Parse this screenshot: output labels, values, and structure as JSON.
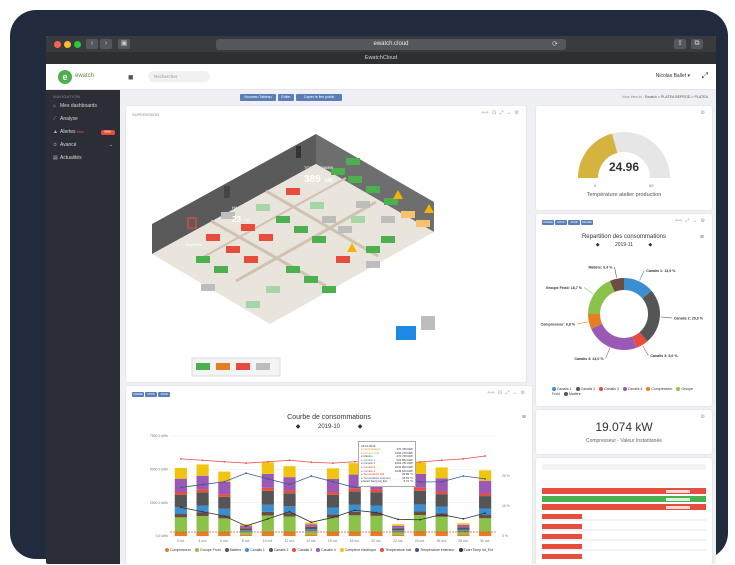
{
  "browser": {
    "url": "ewatch.cloud",
    "tab_title": "EwatchCloud",
    "back": "‹",
    "forward": "›",
    "sidebar_toggle": "▣",
    "reload": "⟳"
  },
  "app": {
    "logo_letter": "e",
    "logo_text": "ewatch",
    "search_placeholder": "Rechercher",
    "user": "Nicolas Ballet ▾",
    "hamburger_icon": "hamburger-icon",
    "expand_icon": "expand-icon"
  },
  "sidebar": {
    "heading": "NAVIGATION",
    "items": [
      {
        "label": "Mes dashboards",
        "icon": "home-icon"
      },
      {
        "label": "Analyse",
        "icon": "chart-icon"
      },
      {
        "label": "Alertes",
        "badge_new": "New",
        "count": "999+",
        "icon": "bell-icon"
      },
      {
        "label": "Avancé",
        "icon": "sliders-icon"
      },
      {
        "label": "Actualités",
        "icon": "news-icon"
      }
    ]
  },
  "actions": {
    "new_dashboard": "Nouveau Tableau",
    "edit": "Editer",
    "copy_public": "Copier le lien public",
    "breadcrumb_prefix": "Vous êtes ici :",
    "breadcrumb_path": "Ewatch > PLATEA BEPROD > PLATEA"
  },
  "supervision": {
    "title": "SUPERVISION",
    "tools": "⟺ ⊡ ⤢ ⌄ ⚙",
    "power_value": "389",
    "power_unit": "kW",
    "power_label": "TOTAL POWER",
    "temp_value": "23",
    "temp_unit": "°C",
    "temp_label": "HALL",
    "zone_label": "PLATEA"
  },
  "gauge": {
    "value": "24.96",
    "min": "0",
    "max": "60",
    "label": "Température atelier production",
    "fraction": 0.416,
    "color_fill": "#d6b23f",
    "color_empty": "#e6e6e6"
  },
  "donut": {
    "buttons": [
      "ANNÉE",
      "MOIS",
      "JOUR",
      "HEURE"
    ],
    "title": "Repartition des consommations",
    "period": "2019-11",
    "prev": "◆",
    "next": "◆",
    "tools": "⟺ ⤢ ⌄ ⚙",
    "menu": "≡"
  },
  "instant": {
    "value": "19.074 kW",
    "label": "Compresseur - Valeur Instantanée"
  },
  "consumption": {
    "buttons": [
      "ANNÉE",
      "MOIS",
      "JOUR"
    ],
    "title": "Courbe de consommations",
    "period": "2019-10",
    "prev": "◆",
    "next": "◆",
    "tools": "⟺ ⊡ ⤢ ⌄ ⚙",
    "menu": "≡",
    "tooltip": {
      "date": "24-10-2019",
      "rows": [
        {
          "name": "Compresseur",
          "value": "370.789 kWh",
          "color": "#e67e22"
        },
        {
          "name": "Groupe froid",
          "value": "1202.279 kWh",
          "color": "#8bc34a"
        },
        {
          "name": "Matière",
          "value": "270.739 kWh",
          "color": "#6d4c41"
        },
        {
          "name": "Canalis 1",
          "value": "524.852 kWh",
          "color": "#3b8fd1"
        },
        {
          "name": "Canalis 2",
          "value": "1024.781 kWh",
          "color": "#555"
        },
        {
          "name": "Canalis 3",
          "value": "2232.052 kWh",
          "color": "#e74c3c"
        },
        {
          "name": "Canalis 4",
          "value": "1035.643 kWh",
          "color": "#9b59b6"
        },
        {
          "name": "Température hall",
          "value": "25.89 °C",
          "color": "#e74c3c"
        },
        {
          "name": "Température extérieur",
          "value": "18.93 °C",
          "color": "#3b5998"
        },
        {
          "name": "Ecart Temp Int_Ext",
          "value": "5.72 °C",
          "color": "#333"
        }
      ]
    }
  },
  "colors": {
    "sidebar_bg": "#2c2e35",
    "accent": "#5b7db8",
    "alert": "#e74c3c",
    "ok": "#4caf50"
  },
  "chart_data": [
    {
      "type": "pie",
      "title": "Repartition des consommations",
      "subtitle": "2019-11",
      "labels": [
        "Canalis 1",
        "Canalis 2",
        "Canalis 3",
        "Canalis 4",
        "Compresseur",
        "Groupe Froid",
        "Matière"
      ],
      "values": [
        13.9,
        25.0,
        5.6,
        24.0,
        6.8,
        18.7,
        6.4
      ],
      "data_labels": [
        "Canalis 1: 13,9 %",
        "Canalis 2: 25,0 %",
        "Canalis 3: 5,6 %",
        "Canalis 4: 24,0 %",
        "Compresseur: 6,8 %",
        "Groupe Froid: 18,7 %",
        "Matière: 6,4 %"
      ],
      "colors": [
        "#3b8fd1",
        "#555555",
        "#e74c3c",
        "#9b59b6",
        "#e67e22",
        "#8bc34a",
        "#6d4c41"
      ],
      "legend": "bottom"
    },
    {
      "type": "bar",
      "title": "Courbe de consommations",
      "subtitle": "2019-10",
      "stacked": true,
      "categories": [
        "2 oct.",
        "4 oct.",
        "6 oct.",
        "8 oct.",
        "10 oct.",
        "12 oct.",
        "14 oct.",
        "16 oct.",
        "18 oct.",
        "20 oct.",
        "22 oct.",
        "24 oct.",
        "26 oct.",
        "28 oct.",
        "30 oct."
      ],
      "y_ticks": [
        "0.0 kWh",
        "2500.0 kWh",
        "5000.0 kWh",
        "7500.0 kWh"
      ],
      "y2_ticks": [
        "0 %",
        "10 %",
        "20 %"
      ],
      "ylim": [
        0,
        7500
      ],
      "series": [
        {
          "name": "Compresseur",
          "color": "#e67e22",
          "values": [
            300,
            350,
            320,
            100,
            360,
            340,
            120,
            330,
            350,
            360,
            100,
            370,
            340,
            120,
            330
          ]
        },
        {
          "name": "Groupe Froid",
          "color": "#8bc34a",
          "values": [
            1100,
            1150,
            1000,
            200,
            1180,
            1120,
            250,
            1050,
            1200,
            1150,
            200,
            1202,
            1100,
            220,
            1000
          ]
        },
        {
          "name": "Matière",
          "color": "#6d4c41",
          "values": [
            250,
            260,
            240,
            50,
            270,
            255,
            60,
            250,
            265,
            260,
            50,
            270,
            250,
            55,
            245
          ]
        },
        {
          "name": "Canalis 1",
          "color": "#3b8fd1",
          "values": [
            500,
            520,
            480,
            80,
            530,
            510,
            90,
            505,
            520,
            515,
            85,
            525,
            500,
            90,
            490
          ]
        },
        {
          "name": "Canalis 2",
          "color": "#555555",
          "values": [
            950,
            1000,
            900,
            150,
            1050,
            980,
            160,
            960,
            1020,
            1000,
            150,
            1025,
            950,
            160,
            930
          ]
        },
        {
          "name": "Canalis 3",
          "color": "#e74c3c",
          "values": [
            200,
            220,
            180,
            30,
            230,
            210,
            40,
            200,
            220,
            210,
            30,
            232,
            200,
            35,
            190
          ]
        },
        {
          "name": "Canalis 4",
          "color": "#9b59b6",
          "values": [
            1000,
            1020,
            950,
            150,
            1040,
            1000,
            160,
            980,
            1030,
            1010,
            150,
            1036,
            990,
            150,
            960
          ]
        },
        {
          "name": "Compteur électrique",
          "color": "#f1c40f",
          "values": [
            800,
            850,
            760,
            120,
            870,
            820,
            130,
            800,
            860,
            840,
            120,
            870,
            810,
            130,
            780
          ]
        }
      ],
      "lines": [
        {
          "name": "Température hall",
          "color": "#e74c3c",
          "values": [
            27,
            26.5,
            26,
            25.5,
            26,
            26.5,
            25.8,
            25.5,
            26,
            26.2,
            25.8,
            25.9,
            26.5,
            27,
            28
          ]
        },
        {
          "name": "Température extérieur",
          "color": "#3b5998",
          "values": [
            17,
            18,
            19,
            22,
            20,
            18,
            21,
            19,
            17,
            18,
            20,
            18.9,
            19,
            21,
            20
          ]
        },
        {
          "name": "Ecart Temp Int_Ext",
          "color": "#333333",
          "values": [
            10,
            8.5,
            7,
            3.5,
            6,
            8.5,
            4.8,
            6.5,
            9,
            8.2,
            5.8,
            5.7,
            7.5,
            6,
            8
          ]
        }
      ],
      "legend": "bottom"
    }
  ]
}
